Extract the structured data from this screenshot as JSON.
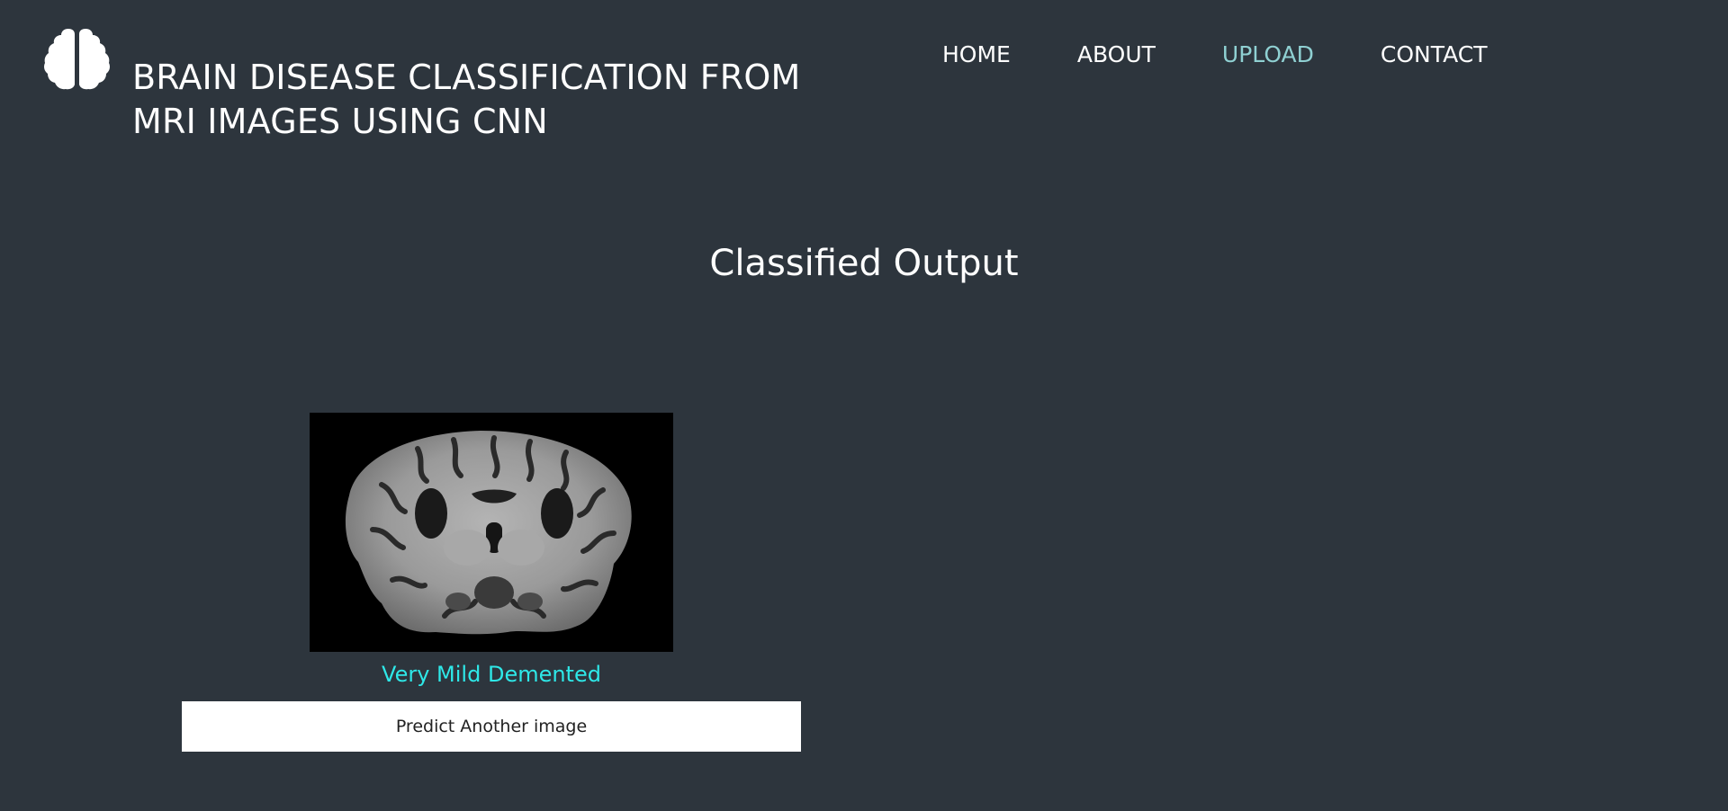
{
  "header": {
    "logo_icon": "brain-icon",
    "title_line1": "BRAIN DISEASE CLASSIFICATION FROM",
    "title_line2": "MRI IMAGES USING CNN"
  },
  "nav": {
    "items": [
      {
        "label": "HOME",
        "active": false
      },
      {
        "label": "ABOUT",
        "active": false
      },
      {
        "label": "UPLOAD",
        "active": true
      },
      {
        "label": "CONTACT",
        "active": false
      }
    ],
    "active_color": "#8fd0d2"
  },
  "main": {
    "heading": "Classified Output",
    "prediction": "Very Mild Demented",
    "prediction_color": "#2ee8e8",
    "button_label": "Predict Another image"
  },
  "colors": {
    "background": "#2d353d",
    "text": "#ffffff"
  }
}
